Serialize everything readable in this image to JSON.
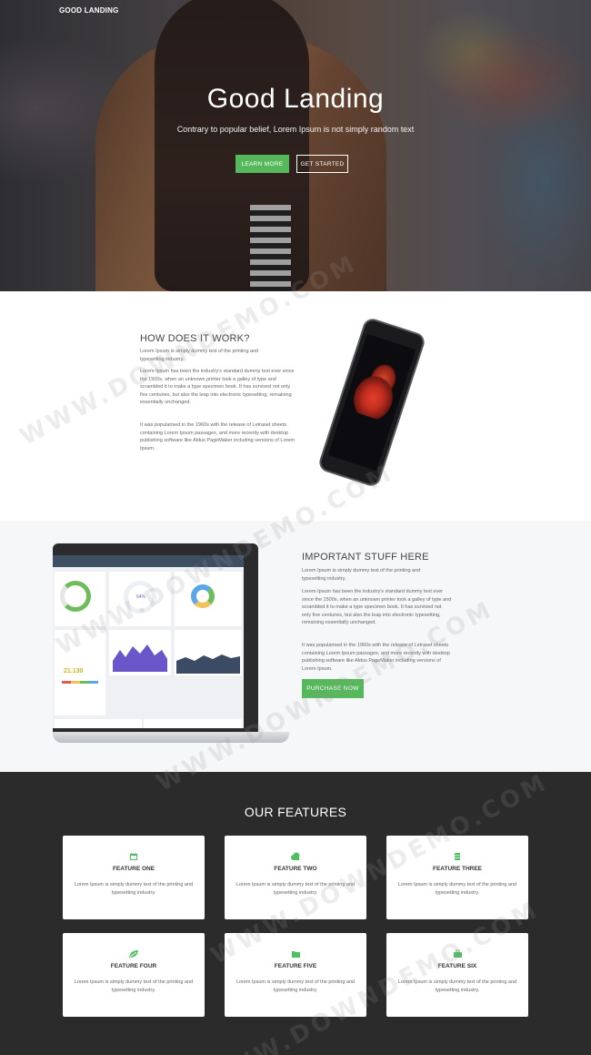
{
  "brand": "GOOD LANDING",
  "hero": {
    "title": "Good Landing",
    "subtitle": "Contrary to popular belief, Lorem Ipsum is not simply random text",
    "btn_learn": "LEARN MORE",
    "btn_start": "GET STARTED"
  },
  "how": {
    "title": "HOW DOES IT WORK?",
    "p1": "Lorem Ipsum is simply dummy text of the printing and typesetting industry.",
    "p2": "Lorem Ipsum has been the industry's standard dummy text ever since the 1500s, when an unknown printer took a galley of type and scrambled it to make a type specimen book. It has survived not only five centuries, but also the leap into electronic typesetting, remaining essentially unchanged.",
    "p3": "It was popularised in the 1960s with the release of Letraset sheets containing Lorem Ipsum passages, and more recently with desktop publishing software like Aldus PageMaker including versions of Lorem Ipsum."
  },
  "important": {
    "title": "IMPORTANT STUFF HERE",
    "p1": "Lorem Ipsum is simply dummy text of the printing and typesetting industry.",
    "p2": "Lorem Ipsum has been the industry's standard dummy text ever since the 1500s, when an unknown printer took a galley of type and scrambled it to make a type specimen book. It has survived not only five centuries, but also the leap into electronic typesetting, remaining essentially unchanged.",
    "p3": "It was popularised in the 1960s with the release of Letraset sheets containing Lorem Ipsum passages, and more recently with desktop publishing software like Aldus PageMaker including versions of Lorem Ipsum.",
    "btn_purchase": "PURCHASE NOW",
    "dash_percent": "64%",
    "dash_total": "21.130"
  },
  "features": {
    "title": "OUR FEATURES",
    "items": [
      {
        "name": "FEATURE ONE",
        "text": "Lorem Ipsum is simply dummy text of the printing and typesetting industry.",
        "icon": "calendar-icon"
      },
      {
        "name": "FEATURE TWO",
        "text": "Lorem Ipsum is simply dummy text of the printing and typesetting industry.",
        "icon": "cloud-icon"
      },
      {
        "name": "FEATURE THREE",
        "text": "Lorem Ipsum is simply dummy text of the printing and typesetting industry.",
        "icon": "database-icon"
      },
      {
        "name": "FEATURE FOUR",
        "text": "Lorem Ipsum is simply dummy text of the printing and typesetting industry.",
        "icon": "leaf-icon"
      },
      {
        "name": "FEATURE FIVE",
        "text": "Lorem Ipsum is simply dummy text of the printing and typesetting industry.",
        "icon": "folder-icon"
      },
      {
        "name": "FEATURE SIX",
        "text": "Lorem Ipsum is simply dummy text of the printing and typesetting industry.",
        "icon": "briefcase-icon"
      }
    ]
  },
  "watermark": "WWW.DOWNDEMO.COM",
  "colors": {
    "accent": "#55b85a",
    "dark": "#2b2b2b",
    "light_bg": "#f6f7f9"
  }
}
